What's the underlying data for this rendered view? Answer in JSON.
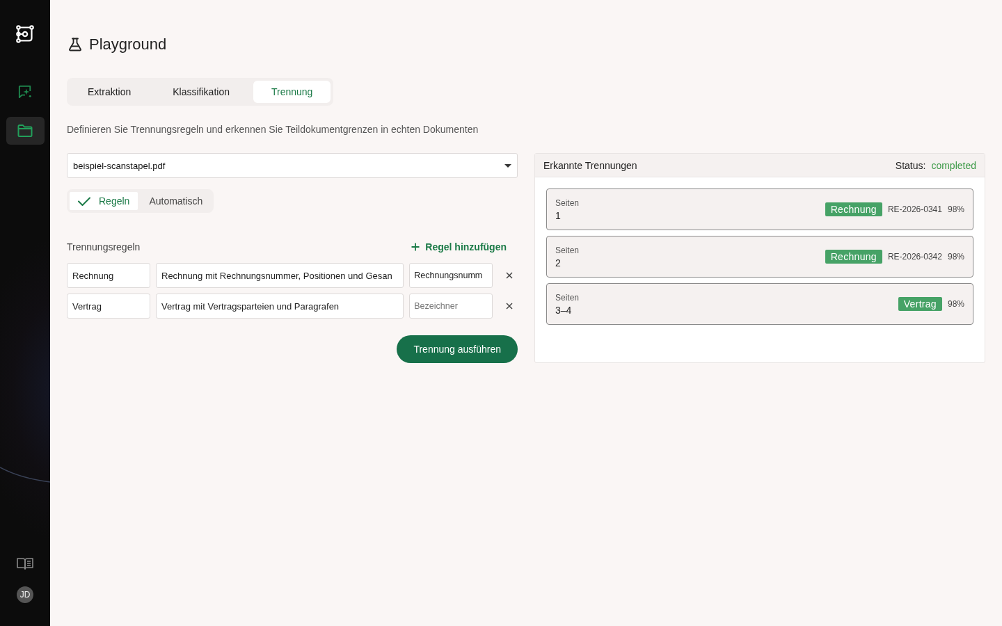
{
  "sidebar": {
    "nav_items": [
      {
        "selected": false
      },
      {
        "selected": true
      }
    ],
    "avatar": "JD"
  },
  "page": {
    "title": "Playground"
  },
  "tabs": [
    {
      "label": "Extraktion",
      "selected": false
    },
    {
      "label": "Klassifikation",
      "selected": false
    },
    {
      "label": "Trennung",
      "selected": true
    }
  ],
  "description": "Definieren Sie Trennungsregeln und erkennen Sie Teildokumentgrenzen in echten Dokumenten",
  "file_select": {
    "value": "beispiel-scanstapel.pdf"
  },
  "modes": [
    {
      "label": "Regeln",
      "selected": true
    },
    {
      "label": "Automatisch",
      "selected": false
    }
  ],
  "rules": {
    "title": "Trennungsregeln",
    "add_label": "Regel hinzufügen",
    "rows": [
      {
        "name": {
          "value": "Rechnung"
        },
        "description": {
          "value": "Rechnung mit Rechnungsnummer, Positionen und Gesan"
        },
        "identifier": {
          "value": "Rechnungsnumm"
        }
      },
      {
        "name": {
          "value": "Vertrag"
        },
        "description": {
          "value": "Vertrag mit Vertragsparteien und Paragrafen"
        },
        "identifier": {
          "placeholder": "Bezeichner"
        }
      }
    ]
  },
  "run_button": "Trennung ausführen",
  "results": {
    "title": "Erkannte Trennungen",
    "status_label": "Status:",
    "status": "completed",
    "segments": [
      {
        "pages_label": "Seiten",
        "pages": "1",
        "type": "Rechnung",
        "reference": "RE-2026-0341",
        "confidence": "98%"
      },
      {
        "pages_label": "Seiten",
        "pages": "2",
        "type": "Rechnung",
        "reference": "RE-2026-0342",
        "confidence": "98%"
      },
      {
        "pages_label": "Seiten",
        "pages": "3–4",
        "type": "Vertrag",
        "confidence": "98%"
      }
    ]
  }
}
